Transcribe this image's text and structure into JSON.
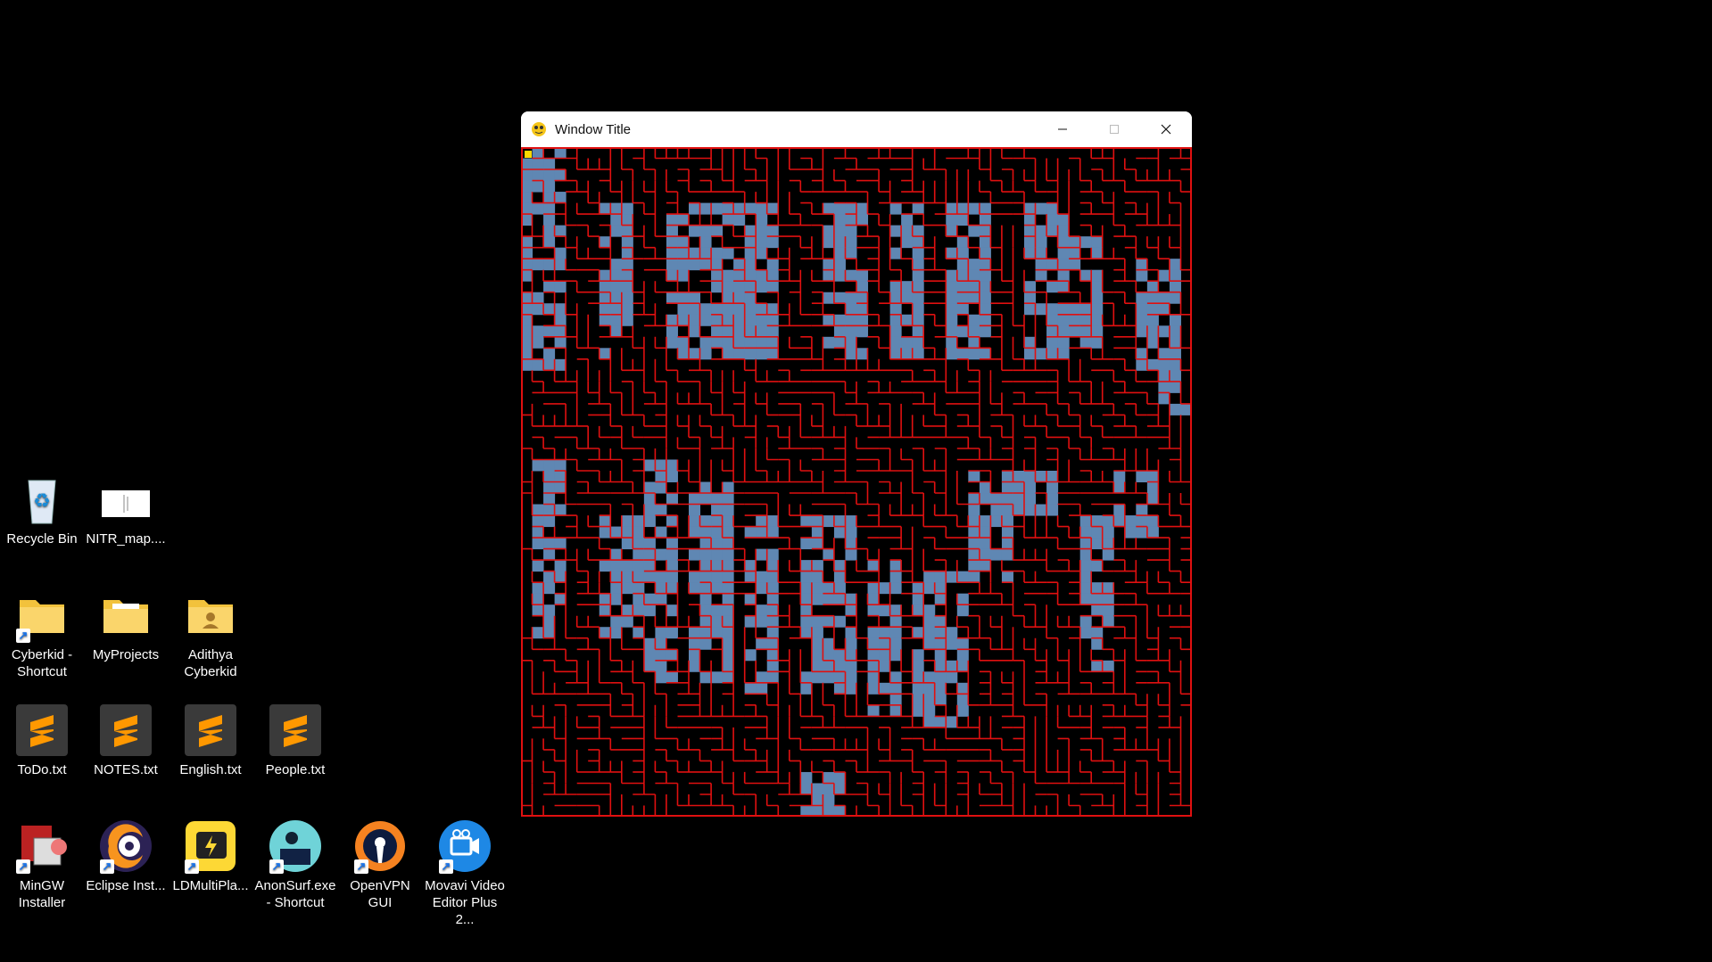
{
  "desktop": {
    "icons": [
      {
        "label": "Recycle Bin",
        "icon": "recycle-bin-icon"
      },
      {
        "label": "NITR_map....",
        "icon": "image-thumbnail-icon"
      },
      {
        "label": "Cyberkid -\nShortcut",
        "icon": "folder-icon"
      },
      {
        "label": "MyProjects",
        "icon": "folder-icon"
      },
      {
        "label": "Adithya\nCyberkid",
        "icon": "user-folder-icon"
      },
      {
        "label": "ToDo.txt",
        "icon": "sublime-text-icon"
      },
      {
        "label": "NOTES.txt",
        "icon": "sublime-text-icon"
      },
      {
        "label": "English.txt",
        "icon": "sublime-text-icon"
      },
      {
        "label": "People.txt",
        "icon": "sublime-text-icon"
      },
      {
        "label": "MinGW\nInstaller",
        "icon": "mingw-installer-icon"
      },
      {
        "label": "Eclipse Inst...",
        "icon": "eclipse-installer-icon"
      },
      {
        "label": "LDMultiPla...",
        "icon": "ldmultiplayer-icon"
      },
      {
        "label": "AnonSurf.exe\n- Shortcut",
        "icon": "anonsurf-icon"
      },
      {
        "label": "OpenVPN\nGUI",
        "icon": "openvpn-icon"
      },
      {
        "label": "Movavi Video\nEditor Plus 2...",
        "icon": "movavi-icon"
      }
    ]
  },
  "window": {
    "title": "Window Title",
    "icon": "pygame-snake-icon",
    "controls": [
      "minimize",
      "maximize",
      "close"
    ]
  },
  "maze": {
    "wall_color": "#e01010",
    "visited_color": "#5f87b3",
    "background_color": "#000000",
    "player_color": "#ffd800"
  },
  "colors": {
    "desktop_background": "#000000",
    "titlebar": "#ffffff"
  }
}
